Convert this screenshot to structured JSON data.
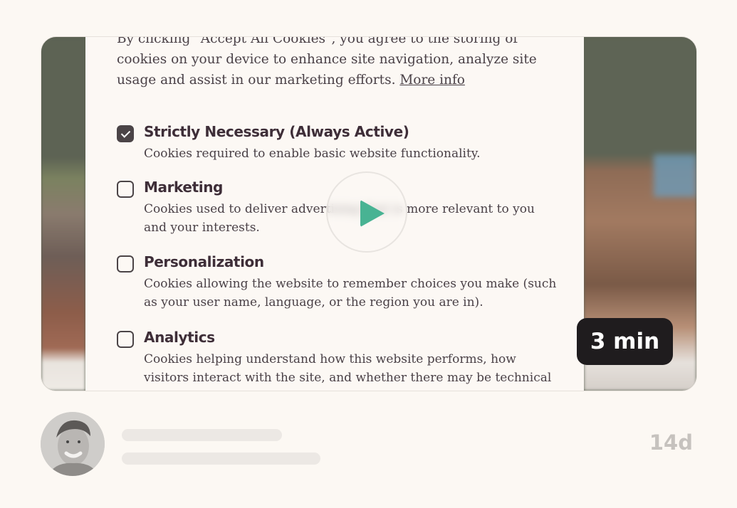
{
  "video": {
    "intro_text": "By clicking \"Accept All Cookies\", you agree to the storing of cookies on your device to enhance site navigation, analyze site usage and assist in our marketing efforts.",
    "more_info_label": "More info",
    "options": [
      {
        "title": "Strictly Necessary (Always Active)",
        "description": "Cookies required to enable basic website functionality.",
        "checked": true
      },
      {
        "title": "Marketing",
        "description": "Cookies used to deliver advertising that is more relevant to you and your interests.",
        "checked": false
      },
      {
        "title": "Personalization",
        "description": "Cookies allowing the website to remember choices you make (such as your user name, language, or the region you are in).",
        "checked": false
      },
      {
        "title": "Analytics",
        "description": "Cookies helping understand how this website performs, how visitors interact with the site, and whether there may be technical issues.",
        "checked": false
      }
    ],
    "play_icon": "play-icon",
    "duration": "3 min",
    "accent_color": "#48b393"
  },
  "footer": {
    "avatar": "user-avatar",
    "age": "14d"
  }
}
